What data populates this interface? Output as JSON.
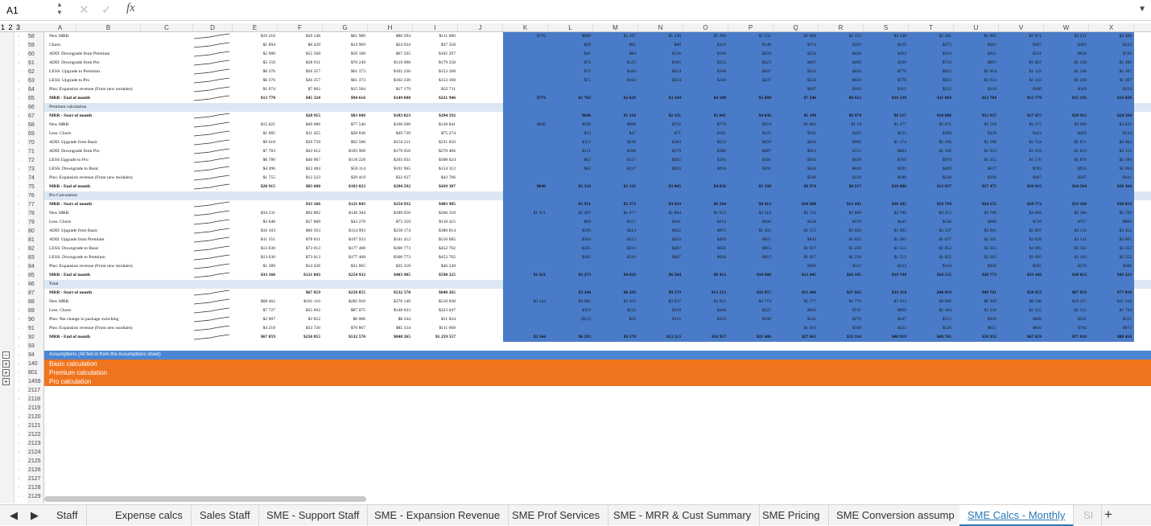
{
  "formula_bar": {
    "name_box": "A1",
    "cancel_icon": "✕",
    "confirm_icon": "✓",
    "fx_label": "fx",
    "formula": ""
  },
  "outline_levels": "1 2 3",
  "columns": [
    "A",
    "B",
    "C",
    "D",
    "E",
    "F",
    "G",
    "H",
    "I",
    "J",
    "K",
    "L",
    "M",
    "N",
    "O",
    "P",
    "Q",
    "R",
    "S",
    "T",
    "U",
    "V",
    "W",
    "X"
  ],
  "rows": [
    {
      "n": "58",
      "label": "New MRR",
      "v": [
        "$19 210",
        "$39 148",
        "$61 986",
        "$80 594",
        "$111 686",
        "",
        "$776",
        "$988",
        "$1 107",
        "$1 230",
        "$1 290",
        "$1 531",
        "$1 660",
        "$1 153",
        "$2 448",
        "$2 361",
        "$1 995",
        "$1 971",
        "$2 231",
        "$2 408"
      ]
    },
    {
      "n": "59",
      "label": "Churn",
      "v": [
        "$1 894",
        "$6 429",
        "$14 969",
        "$24 934",
        "$37 358",
        "",
        "",
        "$28",
        "$61",
        "$88",
        "$119",
        "$140",
        "$174",
        "$193",
        "$229",
        "$272",
        "$283",
        "$307",
        "$302",
        "$333"
      ]
    },
    {
      "n": "60",
      "label": "ADD: Downgrade from Premium",
      "v": [
        "$2 980",
        "$15 568",
        "$39 188",
        "$67 595",
        "$102 297",
        "",
        "",
        "$41",
        "$84",
        "$136",
        "$196",
        "$259",
        "$334",
        "$416",
        "$264",
        "$264",
        "$351",
        "$531",
        "$620",
        "$726"
      ]
    },
    {
      "n": "61",
      "label": "ADD: Downgrade from Pro",
      "v": [
        "$5 159",
        "$28 911",
        "$70 249",
        "$119 098",
        "$179 258",
        "",
        "",
        "$73",
        "$125",
        "$185",
        "$252",
        "$323",
        "$407",
        "$496",
        "$599",
        "$733",
        "$897",
        "$1 067",
        "$1 228",
        "$1 406"
      ]
    },
    {
      "n": "62",
      "label": "LESS: Upgrade to Premium",
      "v": [
        "$6 376",
        "$26 357",
        "$61 373",
        "$102 230",
        "$153 168",
        "",
        "",
        "$75",
        "$164",
        "$254",
        "$346",
        "$437",
        "$543",
        "$656",
        "$778",
        "$925",
        "$1 054",
        "$1 143",
        "$1 240",
        "$1 367"
      ]
    },
    {
      "n": "63",
      "label": "LESS: Upgrade to Pro",
      "v": [
        "$6 376",
        "$26 357",
        "$61 373",
        "$102 230",
        "$153 168",
        "",
        "",
        "$75",
        "$164",
        "$254",
        "$346",
        "$437",
        "$543",
        "$656",
        "$778",
        "$925",
        "$1 054",
        "$1 143",
        "$1 240",
        "$1 367"
      ]
    },
    {
      "n": "64",
      "label": "Plus: Expansion revenue (From new modules)",
      "v": [
        "$1 074",
        "$7 062",
        "$15 584",
        "$17 179",
        "$22 711",
        "",
        "",
        "",
        "",
        "",
        "",
        "",
        "$497",
        "$103",
        "$112",
        "$135",
        "$118",
        "$100",
        "$118",
        "$154"
      ]
    },
    {
      "n": "65",
      "label": "MRR - End of month",
      "bold": true,
      "v": [
        "$13 778",
        "$45 324",
        "$94 616",
        "$149 688",
        "$221 946",
        "",
        "$776",
        "$1 702",
        "$2 629",
        "$3 584",
        "$4 508",
        "$5 608",
        "$7 246",
        "$8 612",
        "$10 239",
        "$11 669",
        "$12 704",
        "$13 778",
        "$15 192",
        "$16 820"
      ]
    },
    {
      "n": "66",
      "label": "Premium calculation",
      "section": true,
      "v": []
    },
    {
      "n": "67",
      "label": "MRR - Start of month",
      "bold": true,
      "v": [
        "",
        "$20 915",
        "$83 688",
        "$183 023",
        "$294 592",
        "",
        "",
        "$646",
        "$1 318",
        "$2 121",
        "$3 045",
        "$4 036",
        "$5 198",
        "$6 974",
        "$8 517",
        "$10 886",
        "$13 937",
        "$17 475",
        "$20 915",
        "$24 564"
      ]
    },
    {
      "n": "68",
      "label": "New MRR",
      "v": [
        "$15 021",
        "$49 086",
        "$77 546",
        "$100 500",
        "$138 841",
        "",
        "$646",
        "$596",
        "$668",
        "$742",
        "$778",
        "$924",
        "$1 002",
        "$1 18",
        "$1 477",
        "$2 075",
        "$2 518",
        "$2 477",
        "$2 900",
        "$3 022"
      ]
    },
    {
      "n": "69",
      "label": "Less: Churn",
      "v": [
        "$1 985",
        "$11 455",
        "$28 836",
        "$49 739",
        "$75 274",
        "",
        "",
        "$23",
        "$47",
        "$71",
        "$101",
        "$125",
        "$161",
        "$185",
        "$225",
        "$268",
        "$338",
        "$422",
        "$456",
        "$534"
      ]
    },
    {
      "n": "70",
      "label": "ADD: Upgrade from Basic",
      "v": [
        "$9 618",
        "$39 759",
        "$92 580",
        "$154 211",
        "$231 050",
        "",
        "",
        "$113",
        "$248",
        "$383",
        "$523",
        "$659",
        "$820",
        "$989",
        "$1 174",
        "$1 396",
        "$1 590",
        "$1 724",
        "$1 871",
        "$2 062"
      ]
    },
    {
      "n": "71",
      "label": "ADD: Downgrade from Pro",
      "v": [
        "$7 783",
        "$43 612",
        "$105 968",
        "$179 656",
        "$270 406",
        "",
        "",
        "$111",
        "$188",
        "$279",
        "$380",
        "$487",
        "$614",
        "$751",
        "$904",
        "$1 106",
        "$1 353",
        "$1 610",
        "$1 853",
        "$2 122"
      ]
    },
    {
      "n": "72",
      "label": "LESS Upgrade to Pro",
      "v": [
        "$6 780",
        "$46 967",
        "$118 228",
        "$203 931",
        "$308 624",
        "",
        "",
        "$62",
        "$127",
        "$205",
        "$294",
        "$391",
        "$504",
        "$628",
        "$766",
        "$978",
        "$1 255",
        "$1 570",
        "$1 870",
        "$2 189"
      ]
    },
    {
      "n": "73",
      "label": "LESS: Downgrade to Basic",
      "v": [
        "$4 496",
        "$23 484",
        "$59 114",
        "$101 965",
        "$154 312",
        "",
        "",
        "$62",
        "$127",
        "$205",
        "$294",
        "$391",
        "$504",
        "$628",
        "$383",
        "$489",
        "$627",
        "$785",
        "$935",
        "$1 094"
      ]
    },
    {
      "n": "74",
      "label": "Plus: Expansion revenue (From new modules)",
      "v": [
        "$1 755",
        "$12 223",
        "$29 419",
        "$32 637",
        "$42 706",
        "",
        "",
        "",
        "",
        "",
        "",
        "",
        "$509",
        "$126",
        "$188",
        "$228",
        "$296",
        "$407",
        "$387",
        "$411"
      ]
    },
    {
      "n": "75",
      "label": "MRR - End of month",
      "bold": true,
      "v": [
        "$20 915",
        "$83 688",
        "$183 023",
        "$294 592",
        "$439 387",
        "",
        "$646",
        "$1 318",
        "$2 121",
        "$3 045",
        "$4 036",
        "$5 198",
        "$6 974",
        "$8 517",
        "$10 886",
        "$13 937",
        "$17 475",
        "$20 915",
        "$24 564",
        "$28 364"
      ]
    },
    {
      "n": "76",
      "label": "Pro Calculation",
      "section": true,
      "v": []
    },
    {
      "n": "77",
      "label": "MRR - Start of month",
      "bold": true,
      "v": [
        "",
        "$33 166",
        "$121 843",
        "$254 932",
        "$403 985",
        "",
        "",
        "$1 921",
        "$3 273",
        "$4 829",
        "$6 584",
        "$8 413",
        "$10 600",
        "$13 445",
        "$16 185",
        "$19 794",
        "$24 155",
        "$28 773",
        "$33 166",
        "$38 053"
      ]
    },
    {
      "n": "78",
      "label": "New MRR",
      "v": [
        "$34 231",
        "$92 882",
        "$146 384",
        "$189 056",
        "$260 310",
        "",
        "$1 921",
        "$1 497",
        "$1 677",
        "$1 864",
        "$1 954",
        "$2 319",
        "$2 516",
        "$2 808",
        "$3 709",
        "$4 472",
        "$4 796",
        "$4 698",
        "$5 306",
        "$5 726"
      ]
    },
    {
      "n": "79",
      "label": "Less: Churn",
      "v": [
        "$3 848",
        "$17 808",
        "$43 270",
        "$73 359",
        "$110 415",
        "",
        "",
        "$69",
        "$117",
        "$161",
        "$219",
        "$260",
        "$328",
        "$370",
        "$445",
        "$546",
        "$600",
        "$726",
        "$757",
        "$866"
      ]
    },
    {
      "n": "80",
      "label": "ADD: Upgrade from Basic",
      "v": [
        "$16 103",
        "$66 563",
        "$154 993",
        "$258 174",
        "$386 814",
        "",
        "",
        "$189",
        "$414",
        "$642",
        "$875",
        "$1 103",
        "$1 372",
        "$1 656",
        "$1 965",
        "$2 337",
        "$2 661",
        "$2 887",
        "$3 132",
        "$3 452"
      ]
    },
    {
      "n": "81",
      "label": "ADD: Upgrade from Premium",
      "v": [
        "$11 351",
        "$78 631",
        "$197 933",
        "$341 412",
        "$516 685",
        "",
        "",
        "$104",
        "$213",
        "$343",
        "$493",
        "$655",
        "$843",
        "$1 051",
        "$1 282",
        "$1 637",
        "$2 101",
        "$2 629",
        "$3 131",
        "$3 665"
      ]
    },
    {
      "n": "82",
      "label": "LESS: Downgrade to Basic",
      "v": [
        "$13 030",
        "$73 013",
        "$177 408",
        "$300 773",
        "$452 702",
        "",
        "",
        "$185",
        "$316",
        "$467",
        "$636",
        "$815",
        "$1 027",
        "$1 258",
        "$1 513",
        "$1 852",
        "$2 265",
        "$2 695",
        "$3 102",
        "$3 552"
      ]
    },
    {
      "n": "83",
      "label": "LESS: Downgrade to Premium",
      "v": [
        "$13 030",
        "$73 013",
        "$177 408",
        "$300 773",
        "$452 702",
        "",
        "",
        "$185",
        "$316",
        "$467",
        "$636",
        "$815",
        "$1 027",
        "$1 258",
        "$1 513",
        "$1 852",
        "$2 265",
        "$2 695",
        "$3 102",
        "$3 552"
      ]
    },
    {
      "n": "84",
      "label": "Plus: Expansion revenue (From new modules)",
      "v": [
        "$1 389",
        "$14 436",
        "$31 865",
        "$35 318",
        "$46 249",
        "",
        "",
        "",
        "",
        "",
        "",
        "",
        "$496",
        "$111",
        "$123",
        "$164",
        "$200",
        "$295",
        "$276",
        "$306"
      ]
    },
    {
      "n": "85",
      "label": "MRR - End of month",
      "bold": true,
      "v": [
        "$33 166",
        "$121 843",
        "$254 932",
        "$403 985",
        "$598 225",
        "",
        "$1 921",
        "$3 273",
        "$4 829",
        "$6 584",
        "$8 413",
        "$10 600",
        "$13 445",
        "$16 185",
        "$19 794",
        "$24 155",
        "$28 773",
        "$33 166",
        "$38 053",
        "$43 233"
      ]
    },
    {
      "n": "86",
      "label": "Total",
      "section": true,
      "v": []
    },
    {
      "n": "87",
      "label": "MRR - Start of month",
      "bold": true,
      "v": [
        "",
        "$67 859",
        "$250 855",
        "$532 570",
        "$848 265",
        "",
        "",
        "$3 344",
        "$6 293",
        "$9 579",
        "$13 213",
        "$16 957",
        "$21 406",
        "$27 665",
        "$33 314",
        "$40 919",
        "$49 761",
        "$58 952",
        "$67 859",
        "$77 810"
      ]
    },
    {
      "n": "88",
      "label": "New MRR",
      "v": [
        "$68 462",
        "$181 116",
        "$285 916",
        "$370 149",
        "$510 838",
        "",
        "$3 344",
        "$3 081",
        "$3 453",
        "$3 837",
        "$4 022",
        "$4 774",
        "$5 177",
        "$5 779",
        "$7 634",
        "$8 908",
        "$9 309",
        "$9 146",
        "$10 337",
        "$11 156"
      ]
    },
    {
      "n": "89",
      "label": "Less: Churn",
      "v": [
        "$7 727",
        "$35 692",
        "$87 075",
        "$148 033",
        "$223 047",
        "",
        "",
        "$119",
        "$225",
        "$319",
        "$440",
        "$525",
        "$663",
        "$747",
        "$899",
        "$1 104",
        "$1 230",
        "$1 455",
        "$1 515",
        "$1 734"
      ]
    },
    {
      "n": "90",
      "label": "Plus: Net change in package switching",
      "v": [
        "$2 907",
        "$3 852",
        "$6 006",
        "$8 244",
        "$11 834",
        "",
        "",
        "($13)",
        "$59",
        "$116",
        "$163",
        "$200",
        "$241",
        "$279",
        "$447",
        "$512",
        "$496",
        "$406",
        "$345",
        "$311"
      ]
    },
    {
      "n": "91",
      "label": "Plus: Expansion revenue (From new modules)",
      "v": [
        "$4 218",
        "$33 720",
        "$76 867",
        "$85 334",
        "$111 668",
        "",
        "",
        "",
        "",
        "",
        "",
        "",
        "$1 503",
        "$340",
        "$423",
        "$526",
        "$615",
        "$810",
        "$784",
        "$873"
      ]
    },
    {
      "n": "92",
      "label": "MRR - End of month",
      "bold": true,
      "v": [
        "$67 859",
        "$250 855",
        "$532 570",
        "$848 265",
        "$1 259 557",
        "",
        "$3 344",
        "$6 293",
        "$9 579",
        "$13 213",
        "$16 957",
        "$21 406",
        "$27 665",
        "$33 314",
        "$40 919",
        "$49 761",
        "$58 952",
        "$67 859",
        "$77 810",
        "$88 416"
      ]
    }
  ],
  "bands": [
    {
      "n": "93",
      "label": "",
      "kind": "blank"
    },
    {
      "n": "94",
      "label": "Assumptions (All fed in from the Assumptions sheet)",
      "kind": "blue"
    },
    {
      "n": "140",
      "label": "Basic calculation",
      "kind": "orange"
    },
    {
      "n": "801",
      "label": "Premium calculation",
      "kind": "orange"
    },
    {
      "n": "1459",
      "label": "Pro calculation",
      "kind": "orange"
    }
  ],
  "empty_rows": [
    "2117",
    "2118",
    "2119",
    "2120",
    "2121",
    "2122",
    "2123",
    "2124",
    "2125",
    "2126",
    "2127",
    "2128",
    "2129"
  ],
  "tabs": [
    "Staff",
    "Expense calcs",
    "Sales Staff",
    "SME - Support Staff",
    "SME - Expansion Revenue",
    "SME Prof Services",
    "SME - MRR & Cust Summary",
    "SME Pricing",
    "SME Conversion assump",
    "SME Calcs - Monthly",
    "SI"
  ],
  "active_tab": "SME Calcs - Monthly",
  "nav": {
    "prev": "◀",
    "next": "▶",
    "add": "+"
  },
  "colors": {
    "accent": "#2a7ab8",
    "highlight": "#4a7bc8",
    "orange": "#f0741e",
    "section": "#dbe8f4"
  }
}
